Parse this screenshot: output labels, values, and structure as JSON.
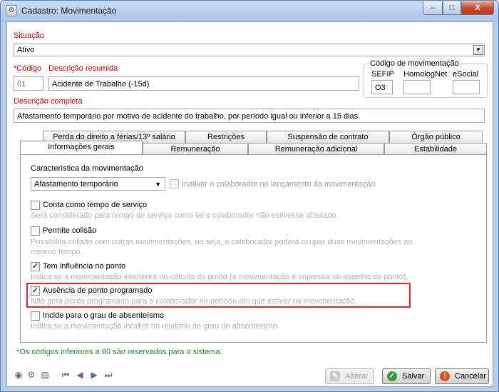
{
  "window": {
    "title": "Cadastro: Movimentação",
    "min": "–",
    "max": "□",
    "close": "X"
  },
  "situacao": {
    "label": "Situação",
    "value": "Ativo"
  },
  "codigo": {
    "label": "*Código",
    "value": "01"
  },
  "descricao_resumida": {
    "label": "Descrição resumida",
    "value": "Acidente de Trabalho (-15d)"
  },
  "codigo_movimentacao": {
    "legend": "Código de movimentação",
    "sefip_label": "SEFIP",
    "sefip_value": "O3",
    "homolognet_label": "HomologNet",
    "homolognet_value": "",
    "esocial_label": "eSocial",
    "esocial_value": ""
  },
  "descricao_completa": {
    "label": "Descrição completa",
    "value": "Afastamento temporário por motivo de acidente do trabalho, por período igual ou inferior a 15 dias."
  },
  "tabs_row1": [
    "Perda do direito a férias/13º salário",
    "Restrições",
    "Suspensão de contrato",
    "Órgão público"
  ],
  "tabs_row2": [
    "Informações gerais",
    "Remuneração",
    "Remuneração adicional",
    "Estabilidade"
  ],
  "panel": {
    "caracteristica_label": "Característica da movimentação",
    "caracteristica_value": "Afastamento temporário",
    "inativar_label": "Inativar o colaborador no lançamento da movimentação",
    "options": [
      {
        "label": "Conta como tempo de serviço",
        "checked": false,
        "hint": "Será considerado para tempo de serviço como se o colaborador não estivesse afastado."
      },
      {
        "label": "Permite colisão",
        "checked": false,
        "hint": "Possibilita colisão com outras movimentações, ou seja, o colaborador poderá ocupar duas movimentações ao",
        "hint2": "mesmo tempo."
      },
      {
        "label": "Tem influência no ponto",
        "checked": true,
        "hint": "Indica se a movimentação interferirá no cálculo do ponto (a movimentação é impressa no espelho de ponto)."
      },
      {
        "label": "Ausência de ponto programado",
        "checked": true,
        "hint": "Não gera ponto programado para o colaborador no período em que estiver na movimentação."
      },
      {
        "label": "Incide para o grau de absenteísmo",
        "checked": false,
        "hint": "Indica se a movimentação incidirá no relatório de grau de absenteísmo"
      }
    ]
  },
  "footer_note": "*Os códigos inferiores a 60 são reservados para o sistema.",
  "buttons": {
    "alterar": "Alterar",
    "salvar": "Salvar",
    "cancelar": "Cancelar"
  },
  "check_glyph": "✓"
}
